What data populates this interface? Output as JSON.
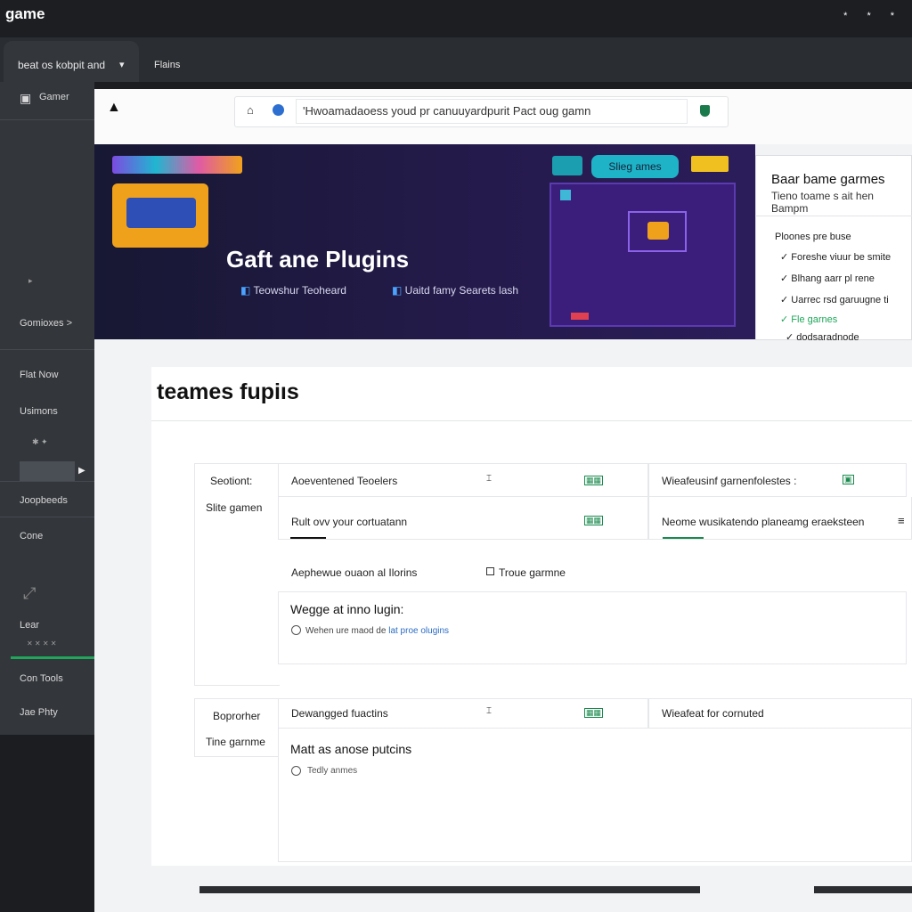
{
  "app": {
    "title": "game"
  },
  "window": {
    "controls": [
      "*",
      "*",
      "*"
    ]
  },
  "tabs": {
    "active_label": "beat os kobpit and",
    "second_label": "Flains"
  },
  "sidebar": {
    "header": "Gamer",
    "items": [
      "Gomioxes >",
      "Flat Now",
      "Usimons",
      "Joopbeeds",
      "Cone",
      "Lear",
      "Con Tools",
      "Jae Phty"
    ]
  },
  "browser": {
    "url_text": "'Hwoamadaoess youd pr canuuyardpurit Pact oug gamn"
  },
  "banner": {
    "title": "Gaft ane Plugins",
    "link_left": "Teowshur Teoheard",
    "link_right": "Uaitd famy Searets lash",
    "button": "Slieg ames"
  },
  "info_card": {
    "title": "Baar bame garmes",
    "subtitle": "Tieno toame s ait hen Bampm",
    "heading": "Ploones pre buse",
    "items": [
      "Foreshe viuur be smite",
      "Blhang aarr pl rene",
      "Uarrec rsd garuugne ti",
      "Fle garnes",
      "dodsaradnode"
    ]
  },
  "section": {
    "title": "teames fupiıs",
    "group1": {
      "label1": "Seotiont:",
      "label2": "Slite gamen",
      "row1_left": "Aoeventened Teoelers",
      "row1_mid": "⌶",
      "row1_right": "Wieafeusinf garnenfolestes :",
      "row2_left": "Rult ovv your cortuatann",
      "row2_right": "Neome wusikatendo planeamg eraeksteen",
      "row3_left": "Aephewue ouaon al Ilorins",
      "row3_right": "Troue garmne",
      "box_title": "Wegge at inno lugin:",
      "box_check_prefix": "Wehen ure maod de",
      "box_check_link": "lat proe olugins"
    },
    "group2": {
      "label1": "Boprorher",
      "label2": "Tine garnme",
      "row1_left": "Dewangged fuactins",
      "row1_mid": "⌶",
      "row1_right": "Wieafeat for cornuted",
      "box_title": "Matt as anose putcins",
      "box_check": "Tedly anmes"
    }
  },
  "colors": {
    "accent_green": "#1fa65a",
    "banner_bg": "#241a4a",
    "button_teal": "#1fb3c8"
  },
  "icons": [
    "lock-icon",
    "globe-icon",
    "shield-icon",
    "menu-icon",
    "chevron-down-icon"
  ]
}
